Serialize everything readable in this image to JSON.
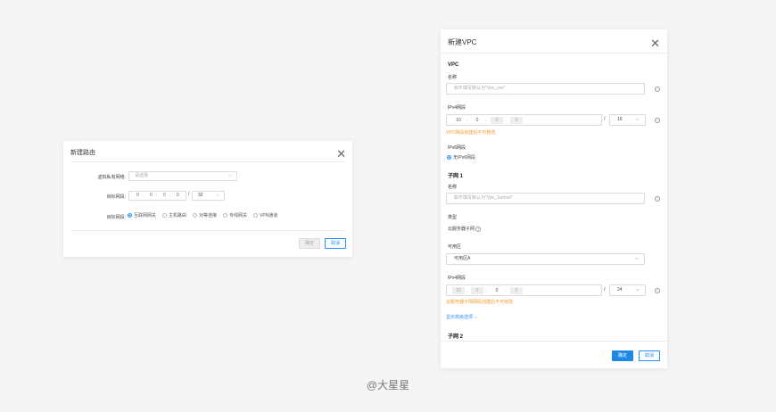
{
  "route_dialog": {
    "title": "新建路由",
    "vpc_label": "虚拟私有网络:",
    "vpc_placeholder": "请选择",
    "dest_label": "目标网段:",
    "dest_octets": [
      "0",
      "0",
      "0",
      "0"
    ],
    "dest_mask": "32",
    "nexthop_label": "目标网段:",
    "nexthop_options": [
      {
        "label": "互联网网关",
        "selected": true
      },
      {
        "label": "主机路由",
        "selected": false
      },
      {
        "label": "对等连接",
        "selected": false
      },
      {
        "label": "专线网关",
        "selected": false
      },
      {
        "label": "VPN通道",
        "selected": false
      }
    ],
    "confirm_label": "确定",
    "cancel_label": "取消"
  },
  "vpc_dialog": {
    "title": "新建VPC",
    "vpc_section": "VPC",
    "name_label": "名称",
    "name_placeholder": "如不填写默认为\"Vpc_xxx\"",
    "ipv4_label": "IPv4网段",
    "ipv4_octets": [
      "10",
      "0",
      "0",
      "0"
    ],
    "ipv4_mask": "16",
    "ipv4_warning": "VPC网段创建后不可修改",
    "ipv6_label": "IPv6网段",
    "ipv6_option": "无IPv6网段",
    "subnet1_section": "子网 1",
    "subnet_name_label": "名称",
    "subnet_name_placeholder": "如不填写默认为\"Vpc_Subnet\"",
    "type_label": "类型",
    "type_value": "云服务器子网",
    "zone_label": "可用区",
    "zone_value": "可用区A",
    "subnet_ipv4_label": "IPv4网段",
    "subnet_ipv4_octets": [
      "10",
      "0",
      "0",
      "0"
    ],
    "subnet_ipv4_mask": "24",
    "subnet_warning": "云服务器子网网段创建后不可修改",
    "advanced_link": "显示高级选项",
    "subnet2_section": "子网 2",
    "confirm_label": "确定",
    "cancel_label": "取消"
  },
  "watermark": "@大星星"
}
